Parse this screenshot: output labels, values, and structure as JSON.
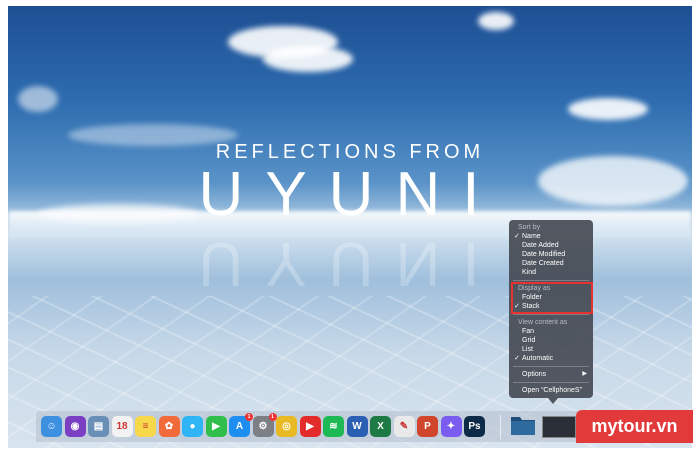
{
  "wallpaper": {
    "title_top": "REFLECTIONS FROM",
    "title_main": "UYUNI",
    "sky_color": "#2e6db0"
  },
  "context_menu": {
    "sort_by_header": "Sort by",
    "sort_items": [
      {
        "label": "Name",
        "checked": true
      },
      {
        "label": "Date Added",
        "checked": false
      },
      {
        "label": "Date Modified",
        "checked": false
      },
      {
        "label": "Date Created",
        "checked": false
      },
      {
        "label": "Kind",
        "checked": false
      }
    ],
    "display_as_header": "Display as",
    "display_items": [
      {
        "label": "Folder",
        "checked": false
      },
      {
        "label": "Stack",
        "checked": true
      }
    ],
    "view_content_header": "View content as",
    "view_items": [
      {
        "label": "Fan",
        "checked": false
      },
      {
        "label": "Grid",
        "checked": false
      },
      {
        "label": "List",
        "checked": false
      },
      {
        "label": "Automatic",
        "checked": true
      }
    ],
    "options_label": "Options",
    "open_label": "Open “CellphoneS”",
    "check_glyph": "✓",
    "arrow_glyph": "▶",
    "highlight_color": "#e8322f"
  },
  "dock": {
    "apps": [
      {
        "name": "finder-icon",
        "glyph": "☺",
        "color": "#3d8fe0"
      },
      {
        "name": "siri-icon",
        "glyph": "◉",
        "color": "#7b3fc4"
      },
      {
        "name": "preview-icon",
        "glyph": "▤",
        "color": "#6a8fb6"
      },
      {
        "name": "calendar-icon",
        "glyph": "18",
        "color": "#f2f2f2"
      },
      {
        "name": "notes-icon",
        "glyph": "≡",
        "color": "#f7d84a"
      },
      {
        "name": "photos-icon",
        "glyph": "✿",
        "color": "#f06a3a"
      },
      {
        "name": "messages-icon",
        "glyph": "●",
        "color": "#2fb5f5"
      },
      {
        "name": "facetime-icon",
        "glyph": "▶",
        "color": "#2fbf4a"
      },
      {
        "name": "app-store-icon",
        "glyph": "A",
        "color": "#1f8ef1",
        "badge": "1"
      },
      {
        "name": "system-preferences-icon",
        "glyph": "⚙",
        "color": "#7c7f86",
        "badge": "1"
      },
      {
        "name": "chrome-icon",
        "glyph": "◎",
        "color": "#e8b923"
      },
      {
        "name": "youtube-icon",
        "glyph": "▶",
        "color": "#e32b2b"
      },
      {
        "name": "spotify-icon",
        "glyph": "≋",
        "color": "#1db954"
      },
      {
        "name": "word-icon",
        "glyph": "W",
        "color": "#2b5fb3"
      },
      {
        "name": "excel-icon",
        "glyph": "X",
        "color": "#1e7a44"
      },
      {
        "name": "textedit-icon",
        "glyph": "✎",
        "color": "#e9e9e9"
      },
      {
        "name": "powerpoint-icon",
        "glyph": "P",
        "color": "#d0452b"
      },
      {
        "name": "messenger-icon",
        "glyph": "✦",
        "color": "#7b5cf0"
      },
      {
        "name": "photoshop-icon",
        "glyph": "Ps",
        "color": "#0d2a47"
      }
    ]
  },
  "brand": {
    "label": "mytour.vn",
    "color": "#e23a3a"
  }
}
